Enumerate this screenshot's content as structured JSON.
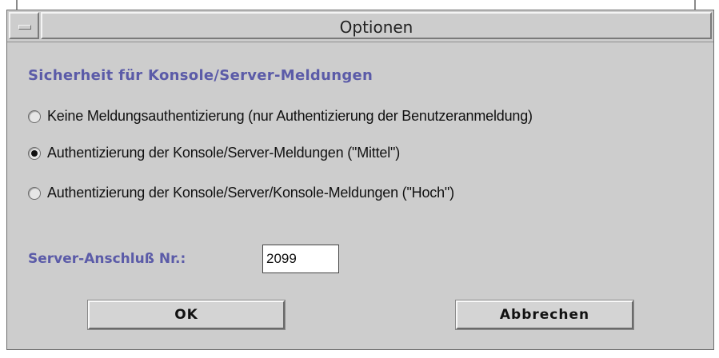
{
  "window": {
    "title": "Optionen"
  },
  "section": {
    "heading": "Sicherheit für Konsole/Server-Meldungen"
  },
  "security_options": [
    {
      "label": "Keine Meldungsauthentizierung (nur Authentizierung der Benutzeranmeldung)",
      "selected": false
    },
    {
      "label": "Authentizierung der Konsole/Server-Meldungen (\"Mittel\")",
      "selected": true
    },
    {
      "label": "Authentizierung der Konsole/Server/Konsole-Meldungen (\"Hoch\")",
      "selected": false
    }
  ],
  "port": {
    "label": "Server-Anschluß Nr.:",
    "value": "2099"
  },
  "buttons": {
    "ok_label": "OK",
    "cancel_label": "Abbrechen"
  },
  "colors": {
    "window_background": "#cdcdcd",
    "heading_color": "#5b5ba8"
  }
}
